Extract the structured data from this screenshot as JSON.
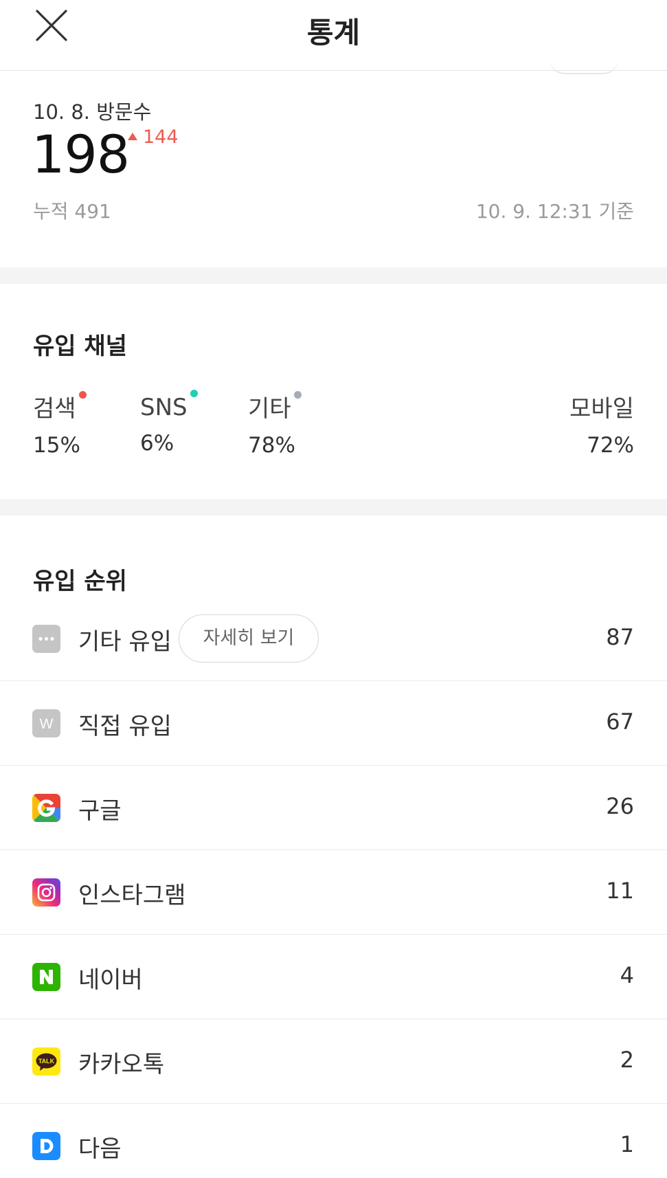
{
  "header": {
    "title": "통계"
  },
  "visits": {
    "date_label": "10. 8. 방문수",
    "count": "198",
    "change": "144",
    "total": "누적 491",
    "updated": "10. 9. 12:31 기준"
  },
  "channels": {
    "title": "유입 채널",
    "items": [
      {
        "name": "검색",
        "value": "15%",
        "dot_color": "#f0554a"
      },
      {
        "name": "SNS",
        "value": "6%",
        "dot_color": "#1fcfb6"
      },
      {
        "name": "기타",
        "value": "78%",
        "dot_color": "#a3acb7"
      },
      {
        "name": "모바일",
        "value": "72%"
      }
    ]
  },
  "ranking": {
    "title": "유입 순위",
    "detail_label": "자세히 보기",
    "items": [
      {
        "icon": "more-icon",
        "label": "기타 유입",
        "count": "87"
      },
      {
        "icon": "direct-w-icon",
        "label": "직접 유입",
        "count": "67"
      },
      {
        "icon": "google-icon",
        "label": "구글",
        "count": "26"
      },
      {
        "icon": "instagram-icon",
        "label": "인스타그램",
        "count": "11"
      },
      {
        "icon": "naver-icon",
        "label": "네이버",
        "count": "4"
      },
      {
        "icon": "kakaotalk-icon",
        "label": "카카오톡",
        "count": "2"
      },
      {
        "icon": "daum-icon",
        "label": "다음",
        "count": "1"
      }
    ]
  }
}
